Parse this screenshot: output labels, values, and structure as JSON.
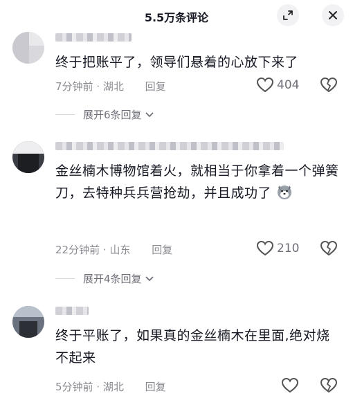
{
  "header": {
    "title": "5.5万条评论"
  },
  "comments": [
    {
      "text": "终于把账平了，领导们悬着的心放下来了",
      "time": "7分钟前",
      "location": "湖北",
      "reply_label": "回复",
      "like_count": "404",
      "replies_label": "展开6条回复"
    },
    {
      "text": "金丝楠木博物馆着火，就相当于你拿着一个弹簧刀，去特种兵兵营抢劫，并且成功了",
      "emoji": "husky-emoji",
      "time": "22分钟前",
      "location": "山东",
      "reply_label": "回复",
      "like_count": "210",
      "replies_label": "展开4条回复"
    },
    {
      "text": "终于平账了，如果真的金丝楠木在里面,绝对烧不起来",
      "time": "5分钟前",
      "location": "湖北",
      "reply_label": "回复",
      "like_count": ""
    }
  ],
  "icons": {
    "expand": "expand-icon",
    "close": "close-icon",
    "like": "heart-icon",
    "dislike": "broken-heart-icon",
    "chevron": "chevron-down-icon"
  },
  "colors": {
    "text": "#161823",
    "secondary": "#8a8b91",
    "icon_bg": "#f2f2f4"
  }
}
